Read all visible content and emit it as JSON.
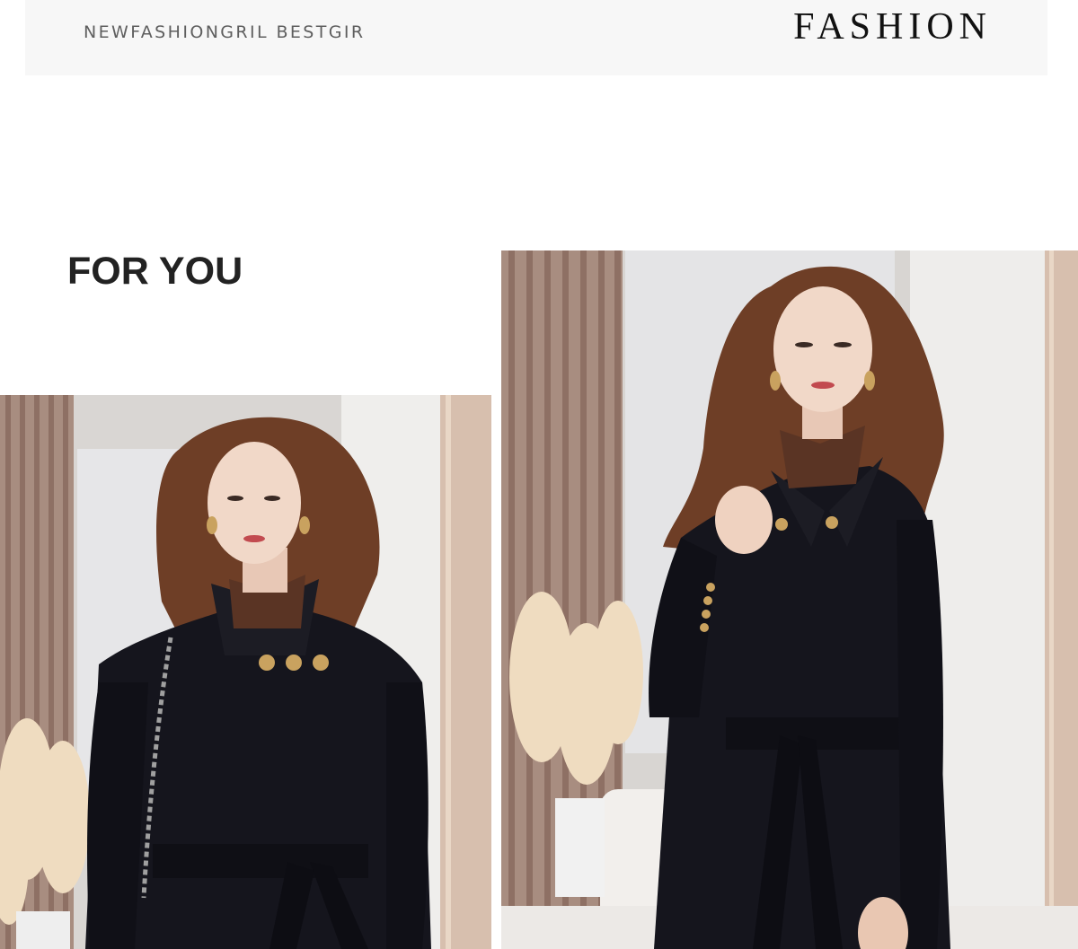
{
  "header": {
    "tagline": "NEWFASHIONGRIL BESTGIR",
    "title": "FASHION"
  },
  "section": {
    "heading": "FOR YOU"
  },
  "photos": [
    {
      "subject": "model-standing-collar-coat"
    },
    {
      "subject": "model-shirt-collar-coat"
    }
  ],
  "colors": {
    "banner_bg": "#f7f7f7",
    "coat": "#15151d",
    "turtleneck": "#5a3424",
    "hair": "#6e3e26",
    "buttons": "#c9a25f",
    "pampas": "#efdcc0",
    "wall_stripe": "#9d7f72"
  }
}
